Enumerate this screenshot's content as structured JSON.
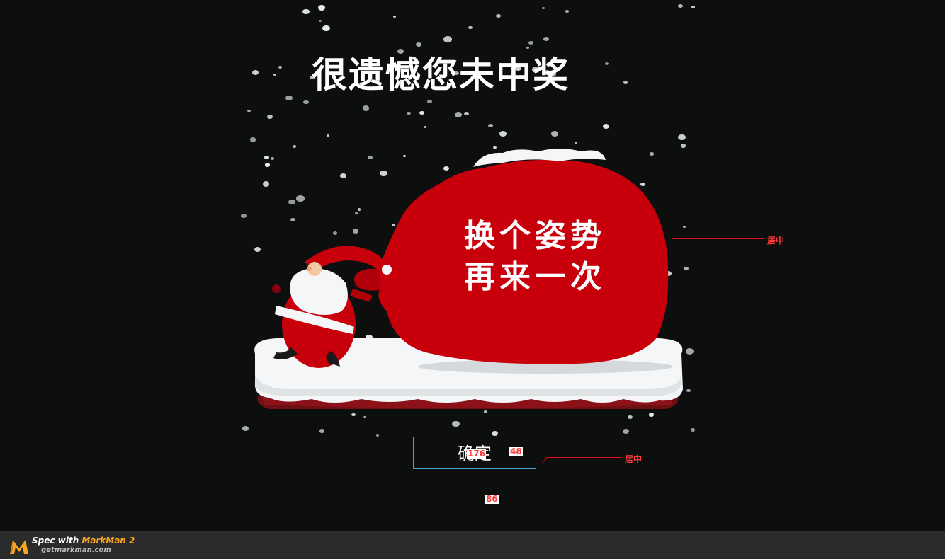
{
  "title": "很遗憾您未中奖",
  "sack": {
    "line1": "换个姿势",
    "line2": "再来一次"
  },
  "confirm_label": "确定",
  "annotations": {
    "center_label": "居中",
    "button_width": "176",
    "button_height": "48",
    "bottom_gap": "86"
  },
  "footer": {
    "spec_prefix": "Spec with ",
    "brand": "MarkMan 2",
    "url": "getmarkman.com"
  },
  "colors": {
    "background": "#0d0f0f",
    "sack_red": "#c8000c",
    "accent_orange": "#f5a623",
    "measure_red": "#ff3b3b",
    "button_border": "#4aa3d8"
  }
}
